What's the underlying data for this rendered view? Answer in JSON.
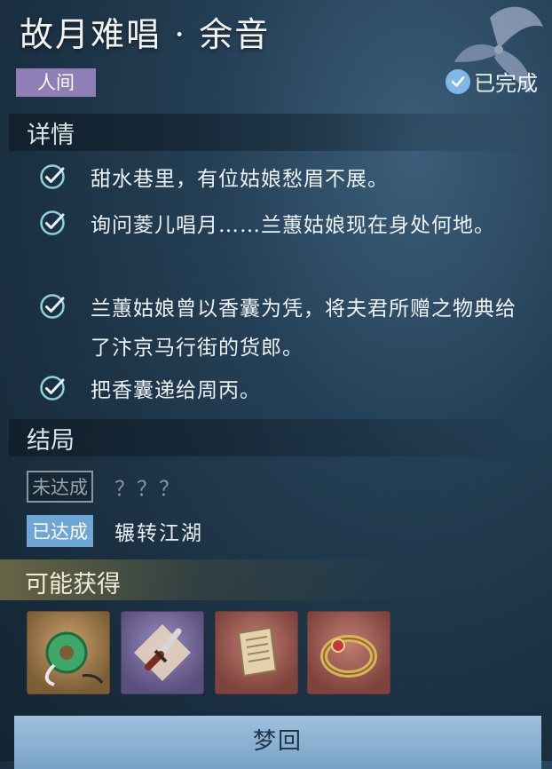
{
  "header": {
    "title": "故月难唱 · 余音",
    "realm_tag": "人间",
    "status_label": "已完成"
  },
  "details": {
    "heading": "详情",
    "tasks": [
      {
        "text": "甜水巷里，有位姑娘愁眉不展。"
      },
      {
        "text": "询问菱儿唱月……兰蕙姑娘现在身处何地。"
      },
      {
        "text": "兰蕙姑娘曾以香囊为凭，将夫君所赠之物典给了汴京马行街的货郎。"
      },
      {
        "text": "把香囊递给周丙。"
      }
    ]
  },
  "endings": {
    "heading": "结局",
    "items": [
      {
        "badge": "未达成",
        "text": "？？？",
        "achieved": false
      },
      {
        "badge": "已达成",
        "text": "辗转江湖",
        "achieved": true
      }
    ]
  },
  "rewards": {
    "heading": "可能获得",
    "items": [
      {
        "icon": "jade-pendant-icon",
        "rarity_color": "#a9834f"
      },
      {
        "icon": "dagger-icon",
        "rarity_color": "#7a6c9c"
      },
      {
        "icon": "scroll-book-icon",
        "rarity_color": "#a8665e"
      },
      {
        "icon": "gem-ring-icon",
        "rarity_color": "#a8665e"
      }
    ]
  },
  "footer": {
    "button_label": "梦回"
  },
  "colors": {
    "accent_blue": "#6ea6d6",
    "realm_tag": "#8f7fb6",
    "check_teal": "#8fd0de"
  }
}
